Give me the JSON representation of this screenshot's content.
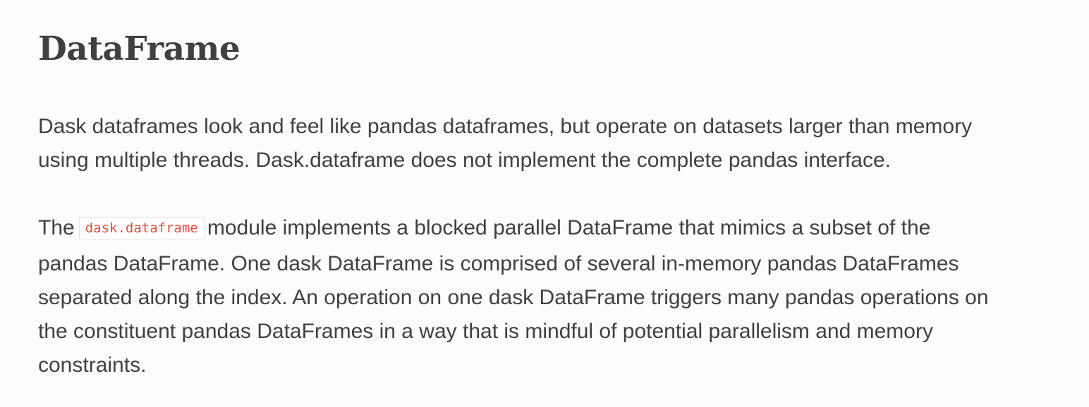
{
  "section": {
    "title": "DataFrame"
  },
  "paragraphs": {
    "intro_line1": "Dask dataframes look and feel like pandas dataframes, but operate on datasets larger than memory",
    "intro_line2": "using multiple threads. Dask.dataframe does not implement the complete pandas interface.",
    "detail_prefix": "The",
    "detail_code": "dask.dataframe",
    "detail_line1_rest": "module implements a blocked parallel DataFrame that mimics a subset of the",
    "detail_line2": "pandas DataFrame. One dask DataFrame is comprised of several in-memory pandas DataFrames",
    "detail_line3": "separated along the index. An operation on one dask DataFrame triggers many pandas operations on",
    "detail_line4": "the constituent pandas DataFrames in a way that is mindful of potential parallelism and memory",
    "detail_line5": "constraints."
  },
  "colors": {
    "text": "#404040",
    "code_text": "#e74c3c",
    "background": "#fcfcfc"
  }
}
